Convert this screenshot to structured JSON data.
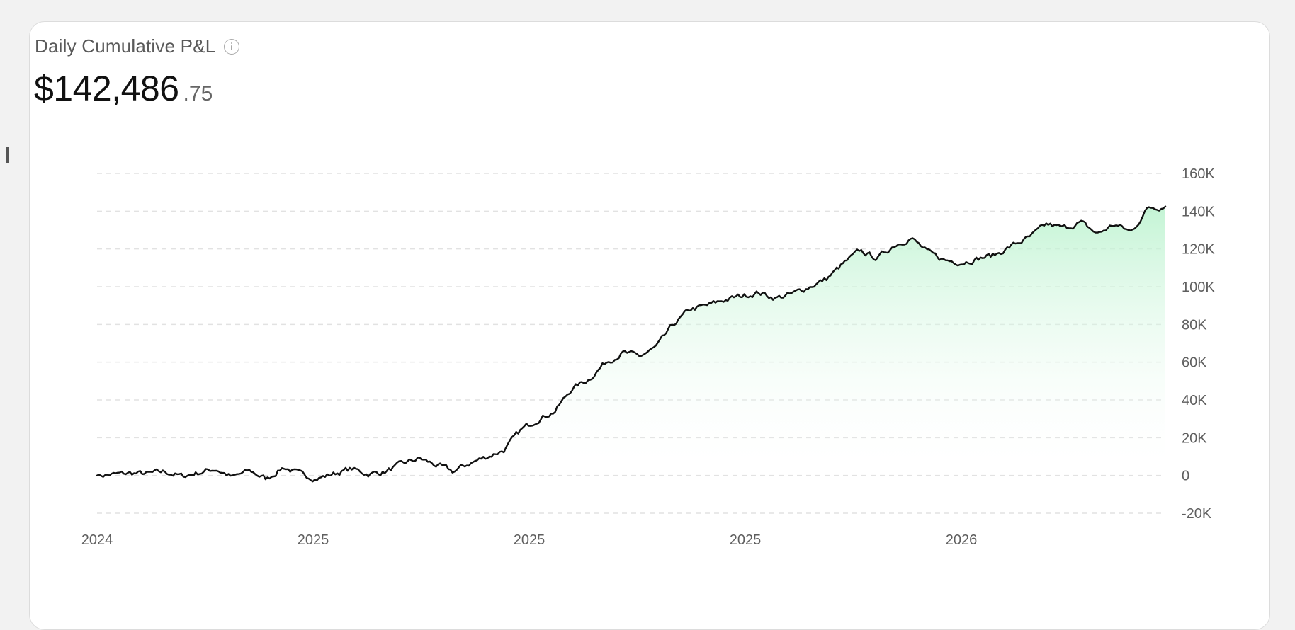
{
  "header": {
    "title": "Daily Cumulative P&L",
    "value_main": "$142,486",
    "value_cents": ".75"
  },
  "colors": {
    "line": "#111111",
    "area_top": "#b9f2cd",
    "gridline": "#e2e2e2"
  },
  "chart_data": {
    "type": "area",
    "title": "Daily Cumulative P&L",
    "xlabel": "",
    "ylabel": "",
    "y_ticks": [
      160000,
      140000,
      120000,
      100000,
      80000,
      60000,
      40000,
      20000,
      0,
      -20000
    ],
    "y_tick_labels": [
      "160K",
      "140K",
      "120K",
      "100K",
      "80K",
      "60K",
      "40K",
      "20K",
      "0",
      "-20K"
    ],
    "x_tick_labels": [
      "2024",
      "2025",
      "2025",
      "2025",
      "2026"
    ],
    "ylim": [
      -20000,
      160000
    ],
    "grid": true,
    "y_axis_side": "right",
    "series": [
      {
        "values": [
          0,
          500,
          1200,
          800,
          2000,
          -500,
          1500,
          3500,
          -1000,
          2500,
          -2000,
          4500,
          500,
          -1500,
          1000,
          3500,
          800,
          2000,
          6000,
          9000,
          5500,
          2000,
          6500,
          10000,
          13500,
          24000,
          30000,
          34000,
          46000,
          51000,
          60000,
          65000,
          63000,
          68000,
          80000,
          88000,
          90000,
          93000,
          95000,
          97000,
          94000,
          96000,
          100000,
          104000,
          112000,
          119000,
          115000,
          122000,
          126000,
          118000,
          114000,
          113000,
          115000,
          117000,
          122000,
          126000,
          133000,
          131000,
          134000,
          128000,
          133000,
          129000,
          142000,
          142486.75
        ]
      }
    ]
  }
}
